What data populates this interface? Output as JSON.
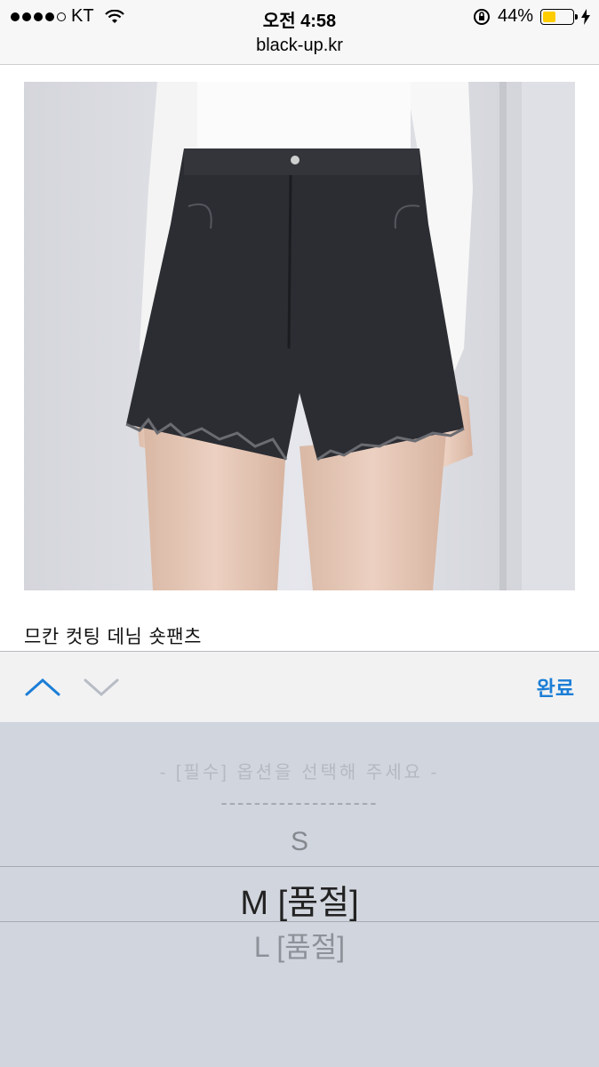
{
  "status_bar": {
    "carrier": "KT",
    "time": "오전 4:58",
    "battery": "44%",
    "battery_level": 0.44
  },
  "url": "black-up.kr",
  "product": {
    "title": "므칸 컷팅 데님 숏팬츠"
  },
  "toolbar": {
    "done_label": "완료"
  },
  "picker": {
    "options": [
      "- [필수] 옵션을 선택해 주세요 -",
      "-------------------",
      "S",
      "M [품절]",
      "L [품절]"
    ],
    "selected": "M [품절]"
  },
  "colors": {
    "accent": "#1c7ed6",
    "picker_bg": "#d1d5de",
    "battery": "#ffcc00"
  }
}
